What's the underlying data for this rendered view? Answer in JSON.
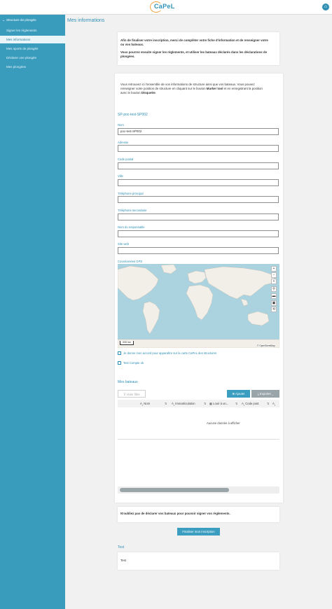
{
  "header": {
    "logo_text": "CaPeL",
    "user_icon": "user-icon"
  },
  "sidebar": {
    "section_label": "Structure de plongée",
    "items": [
      {
        "label": "Signer les règlements",
        "active": false
      },
      {
        "label": "Mes informations",
        "active": true
      },
      {
        "label": "Mes sports de plongée",
        "active": false
      },
      {
        "label": "Déclarer une plongée",
        "active": false
      },
      {
        "label": "Mes plongées",
        "active": false
      }
    ]
  },
  "page": {
    "title": "Mes informations"
  },
  "intro": {
    "line1": "Afin de finaliser votre inscription, merci de compléter votre fiche d'information et de renseigner votre",
    "line2": "ou vos bateaux.",
    "line3": "Vous pourrez ensuite signer les règlements, et utiliser les bateaux déclarés dans les déclarations de",
    "line4": "plongées."
  },
  "info": {
    "line1": "Vous retrouvez ici l'ensemble de vos informations de structure ainsi que vos bateaux. Vous pouvez",
    "line2_a": "renseigner votre position de structure en cliquant sur le bouton ",
    "line2_b": "Marker tool",
    "line2_c": " et en enregistrant la position",
    "line3_a": "avec le bouton ",
    "line3_b": "Disquette",
    "line3_c": "."
  },
  "structure": {
    "title": "SP-poc-test-SP002",
    "fields": {
      "nom": {
        "label": "Nom",
        "value": "poc-test-SP002"
      },
      "adresse": {
        "label": "Adresse",
        "value": ""
      },
      "code_postal": {
        "label": "Code postal",
        "value": ""
      },
      "ville": {
        "label": "Ville",
        "value": ""
      },
      "telephone_principal": {
        "label": "Téléphone principal",
        "value": ""
      },
      "telephone_secondaire": {
        "label": "Téléphone secondaire",
        "value": ""
      },
      "nom_responsable": {
        "label": "Nom du responsable",
        "value": ""
      },
      "site_web": {
        "label": "Site web",
        "value": ""
      },
      "gps": {
        "label": "Coordonnées GPS"
      }
    },
    "map": {
      "scale": "2000 km",
      "attribution": "© OpenStreetMap"
    },
    "consent_label": "Je donne mon accord pour apparaître sur la carte CaPeL des structures",
    "test_compte_label": "Test Compte ok"
  },
  "bateaux": {
    "title": "Mes bateaux",
    "filter_label": "Vider filtre",
    "add_label": "Ajouter",
    "export_label": "Exporter",
    "columns": [
      "Nom",
      "Immatriculation",
      "Loué à un...",
      "Code post."
    ],
    "empty_text": "Aucune donnée à afficher"
  },
  "reminder": "N'oubliez pas de déclarer vos bateaux pour pouvoir signer vos règlements.",
  "finalize_label": "Finaliser mon inscription",
  "test_section": {
    "title": "Test",
    "body": "Test"
  },
  "colors": {
    "primary": "#3a9cbd",
    "accent": "#2f8fb4",
    "logo_orange": "#f0a03c"
  }
}
